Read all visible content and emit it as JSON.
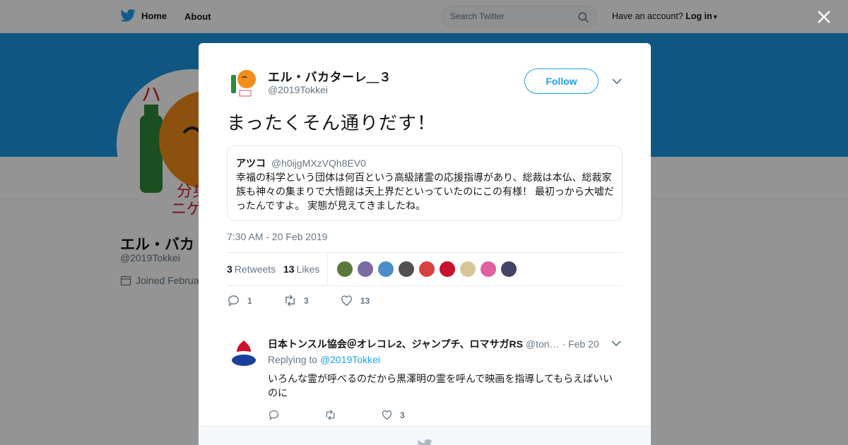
{
  "topbar": {
    "home_label": "Home",
    "about_label": "About",
    "search_placeholder": "Search Twitter",
    "account_prompt": "Have an account?",
    "login_label": "Log in"
  },
  "profile": {
    "name": "エル・バカ",
    "handle": "@2019Tokkei",
    "joined": "Joined Februa"
  },
  "tweet": {
    "author_name": "エル・バカターレ＿３",
    "author_handle": "@2019Tokkei",
    "follow_label": "Follow",
    "text": "まったくそん通りだす！",
    "quote": {
      "name": "アツコ",
      "handle": "@h0ijgMXzVQh8EV0",
      "text": "幸福の科学という団体は何百という高級諸霊の応援指導があり、総裁は本仏、総裁家族も神々の集まりで大悟館は天上界だといっていたのにこの有様！ 最初っから大嘘だったんですよ。 実態が見えてきましたね。"
    },
    "timestamp": "7:30 AM - 20 Feb 2019",
    "retweet_count": "3",
    "retweets_label": "Retweets",
    "like_count": "13",
    "likes_label": "Likes",
    "action_reply_count": "1",
    "action_retweet_count": "3",
    "action_like_count": "13"
  },
  "reply": {
    "name": "日本トンスル協会＠オレコレ2、ジャンプチ、ロマサガRS",
    "handle": "@ton…",
    "time": "· Feb 20",
    "replying_prefix": "Replying to",
    "replying_to": "@2019Tokkei",
    "text": "いろんな霊が呼べるのだから黒澤明の霊を呼んで映画を指導してもらえばいいのに",
    "reply_count": "",
    "retweet_count": "",
    "like_count": "3"
  },
  "colors": {
    "brand_blue": "#1da1f2",
    "banner_blue": "#1b95e0",
    "muted_text": "#657786"
  },
  "liker_colors": [
    "#5a7a3a",
    "#7a6aa0",
    "#4d8cc8",
    "#555050",
    "#d94040",
    "#c8102e",
    "#d9c59a",
    "#e060a0",
    "#444466"
  ]
}
